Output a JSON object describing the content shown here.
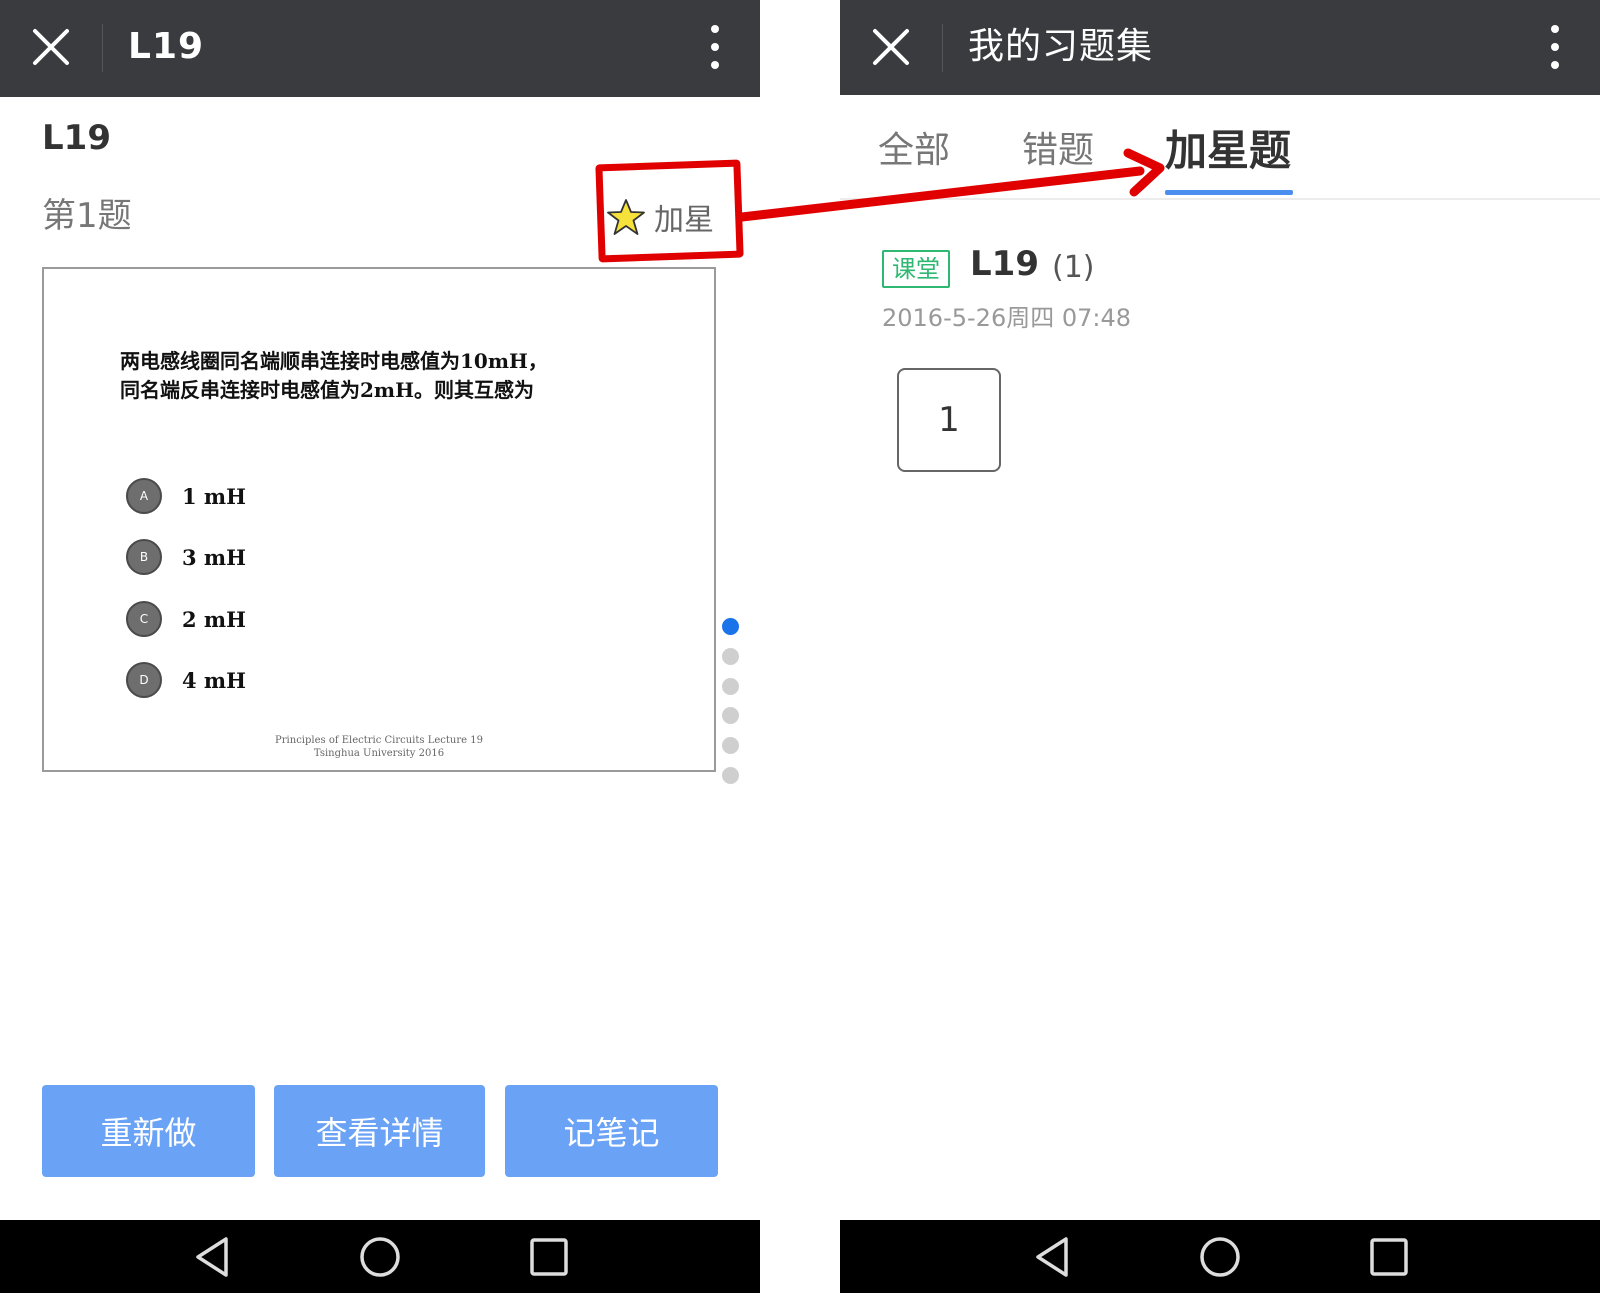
{
  "left_screen": {
    "titlebar": {
      "title": "L19"
    },
    "heading": "L19",
    "question_number": "第1题",
    "star_label": "加星",
    "slide": {
      "question_line1": "两电感线圈同名端顺串连接时电感值为10mH，",
      "question_line2": "同名端反串连接时电感值为2mH。则其互感为",
      "options": [
        {
          "letter": "A",
          "text": "1 mH"
        },
        {
          "letter": "B",
          "text": "3 mH"
        },
        {
          "letter": "C",
          "text": "2 mH"
        },
        {
          "letter": "D",
          "text": "4 mH"
        }
      ],
      "footer_line1": "Principles of Electric Circuits Lecture 19",
      "footer_line2": "Tsinghua University 2016"
    },
    "buttons": {
      "redo": "重新做",
      "details": "查看详情",
      "notes": "记笔记"
    }
  },
  "right_screen": {
    "titlebar": {
      "title": "我的习题集"
    },
    "tabs": [
      {
        "label": "全部",
        "active": false
      },
      {
        "label": "错题",
        "active": false
      },
      {
        "label": "加星题",
        "active": true
      }
    ],
    "item": {
      "tag": "课堂",
      "title": "L19",
      "count": "(1)",
      "date": "2016-5-26周四 07:48",
      "question_tile": "1"
    }
  },
  "colors": {
    "titlebar_bg": "#3a3b3f",
    "action_button": "#6aa2f5",
    "tab_underline": "#4a8ef0",
    "tag_green": "#2eb872",
    "annotation_red": "#e00000",
    "pager_active": "#1a73e8"
  },
  "icons": [
    "close-icon",
    "more-vertical-icon",
    "star-icon",
    "back-triangle-icon",
    "home-circle-icon",
    "recents-square-icon"
  ]
}
